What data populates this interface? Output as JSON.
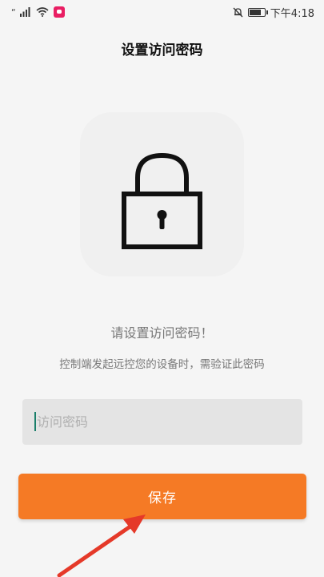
{
  "status_bar": {
    "left_quote": "“",
    "time": "下午4:18",
    "icons": [
      "signal-icon",
      "wifi-icon",
      "app-notification-icon",
      "mute-bell-icon",
      "battery-icon"
    ]
  },
  "page": {
    "title": "设置访问密码"
  },
  "prompt": {
    "title": "请设置访问密码！",
    "subtitle": "控制端发起远控您的设备时，需验证此密码"
  },
  "password_field": {
    "placeholder": "访问密码",
    "value": ""
  },
  "save_button": {
    "label": "保存"
  },
  "colors": {
    "accent": "#f57a25",
    "background": "#f5f5f5",
    "input_background": "#e4e4e4",
    "annotation_arrow": "#e53929"
  }
}
